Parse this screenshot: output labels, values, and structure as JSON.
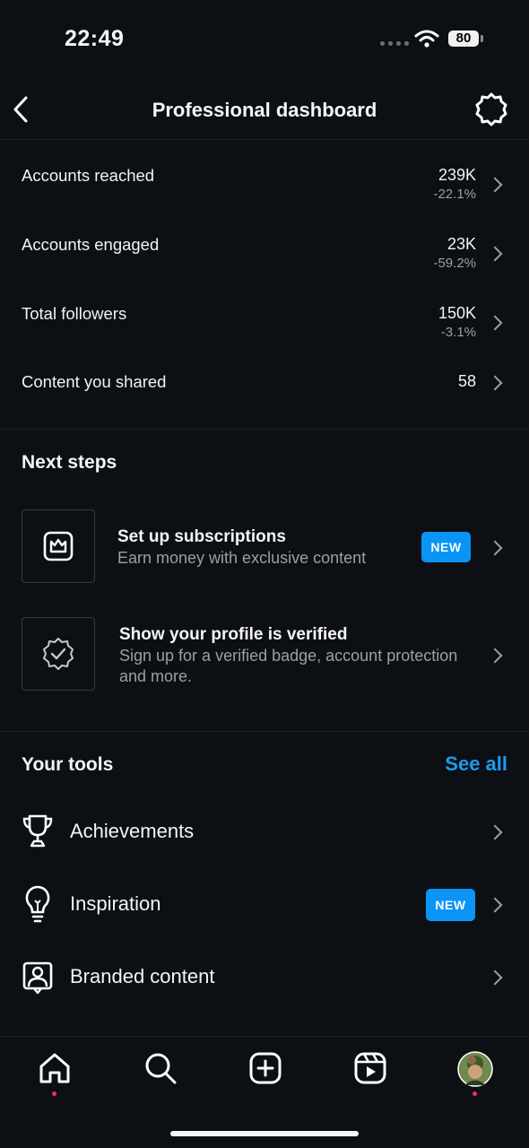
{
  "status_bar": {
    "time": "22:49",
    "battery": "80"
  },
  "header": {
    "title": "Professional dashboard"
  },
  "metrics": [
    {
      "label": "Accounts reached",
      "value": "239K",
      "change": "-22.1%"
    },
    {
      "label": "Accounts engaged",
      "value": "23K",
      "change": "-59.2%"
    },
    {
      "label": "Total followers",
      "value": "150K",
      "change": "-3.1%"
    },
    {
      "label": "Content you shared",
      "value": "58",
      "change": ""
    }
  ],
  "next_steps": {
    "title": "Next steps",
    "items": [
      {
        "title": "Set up subscriptions",
        "subtitle": "Earn money with exclusive content",
        "badge": "NEW"
      },
      {
        "title": "Show your profile is verified",
        "subtitle": "Sign up for a verified badge, account protection and more."
      }
    ]
  },
  "tools": {
    "title": "Your tools",
    "see_all": "See all",
    "items": [
      {
        "label": "Achievements",
        "icon": "trophy-icon"
      },
      {
        "label": "Inspiration",
        "icon": "lightbulb-icon",
        "badge": "NEW"
      },
      {
        "label": "Branded content",
        "icon": "branded-content-icon"
      }
    ]
  },
  "bottom_nav": [
    "home",
    "search",
    "create",
    "reels",
    "profile"
  ],
  "colors": {
    "accent": "#0a95f6",
    "link": "#1d9bf0",
    "notification": "#ff2d55",
    "background": "#0c0f14"
  }
}
